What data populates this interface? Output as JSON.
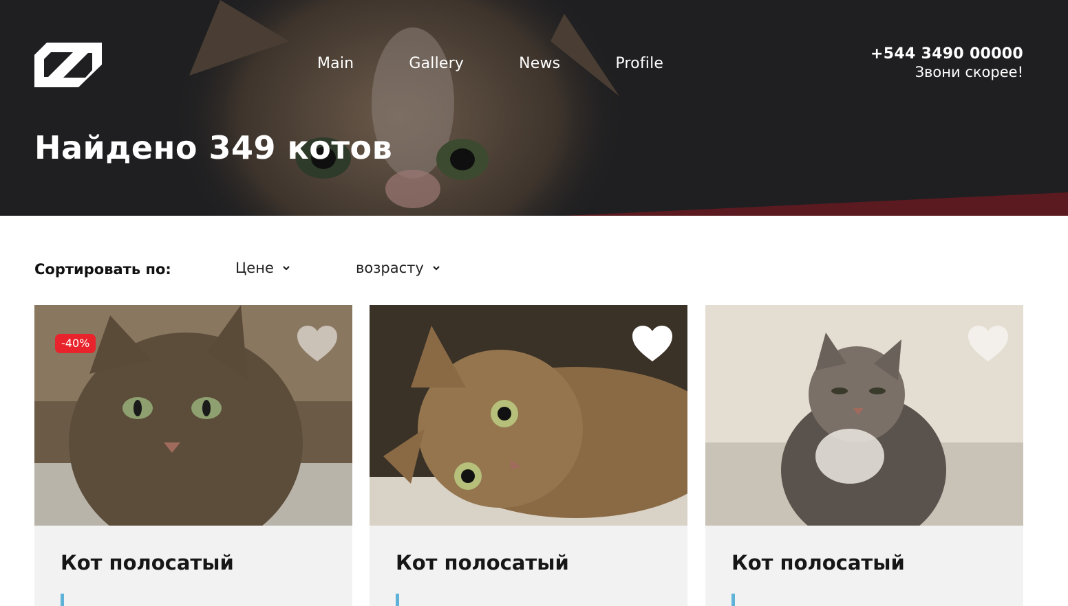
{
  "header": {
    "nav": [
      "Main",
      "Gallery",
      "News",
      "Profile"
    ],
    "phone": "+544 3490 00000",
    "call_text": "Звони скорее!",
    "title": "Найдено 349 котов"
  },
  "sort": {
    "label": "Сортировать по:",
    "options": [
      {
        "label": "Цене",
        "icon": "chevron-down-icon"
      },
      {
        "label": "возрасту",
        "icon": "chevron-down-icon"
      }
    ]
  },
  "cards": [
    {
      "title": "Кот полосатый",
      "badge": "-40%",
      "favorite_icon": "heart-icon",
      "favorited": false
    },
    {
      "title": "Кот полосатый",
      "badge": "",
      "favorite_icon": "heart-icon",
      "favorited": true
    },
    {
      "title": "Кот полосатый",
      "badge": "",
      "favorite_icon": "heart-icon",
      "favorited": false
    }
  ],
  "colors": {
    "hero_bg": "#1f1f21",
    "discount": "#e8232b",
    "accent": "#5fb3d9",
    "card_bg": "#f2f2f2"
  }
}
